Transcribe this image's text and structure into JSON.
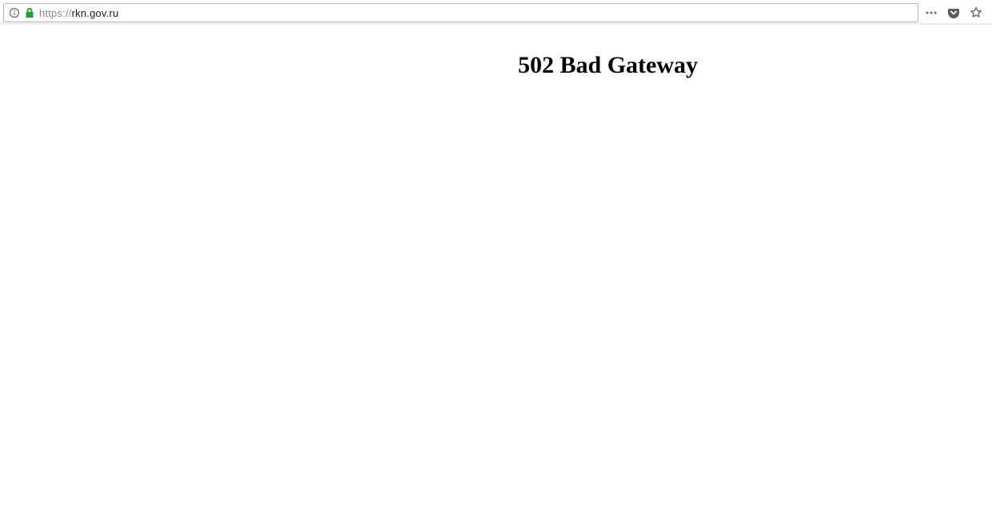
{
  "url": {
    "protocol": "https://",
    "host": "rkn.gov.ru"
  },
  "page": {
    "heading": "502 Bad Gateway"
  }
}
